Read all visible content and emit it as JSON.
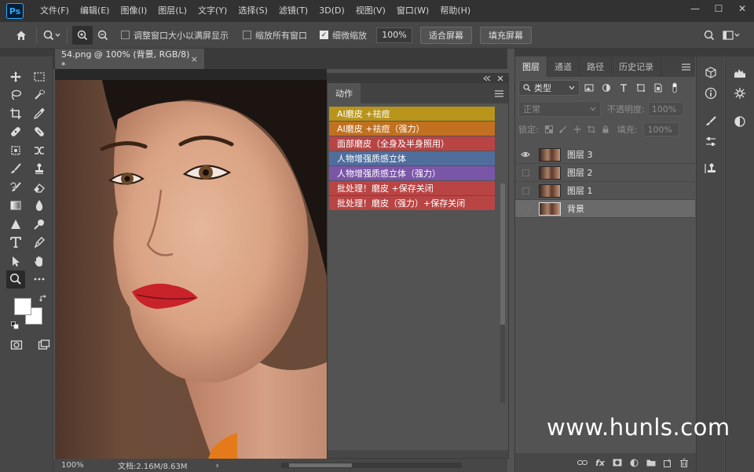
{
  "app": {
    "logo": "Ps",
    "menu": [
      "文件(F)",
      "编辑(E)",
      "图像(I)",
      "图层(L)",
      "文字(Y)",
      "选择(S)",
      "滤镜(T)",
      "3D(D)",
      "视图(V)",
      "窗口(W)",
      "帮助(H)"
    ],
    "window_controls": [
      "—",
      "☐",
      "✕"
    ]
  },
  "options": {
    "resize_windows_label": "调整窗口大小以满屏显示",
    "zoom_all_label": "缩放所有窗口",
    "scrubby_zoom_label": "细微缩放",
    "zoom_value": "100%",
    "fit_screen_label": "适合屏幕",
    "fill_screen_label": "填充屏幕"
  },
  "document": {
    "tab_title": "54.png @ 100% (背景, RGB/8) *",
    "close_glyph": "×"
  },
  "status": {
    "zoom": "100%",
    "doc_info": "文档:2.16M/8.63M",
    "arrow": "›"
  },
  "actions_panel": {
    "tab": "动作",
    "items": [
      {
        "label": "AI磨皮 +祛痘",
        "color": "#b8941a"
      },
      {
        "label": "AI磨皮 +祛痘（强力）",
        "color": "#c1711f"
      },
      {
        "label": "面部磨皮（全身及半身照用）",
        "color": "#b94444"
      },
      {
        "label": "人物增强质感立体",
        "color": "#4f6e9c"
      },
      {
        "label": "人物增强质感立体（强力）",
        "color": "#7a56a8"
      },
      {
        "label": "批处理！磨皮 +保存关闭",
        "color": "#b94444"
      },
      {
        "label": "批处理！磨皮（强力）+保存关闭",
        "color": "#b94444"
      }
    ]
  },
  "layers_panel": {
    "tabs": [
      "图层",
      "通道",
      "路径",
      "历史记录"
    ],
    "filter_label": "类型",
    "blend_mode": "正常",
    "opacity_label": "不透明度:",
    "opacity_value": "100%",
    "lock_label": "锁定:",
    "fill_label": "填充:",
    "fill_value": "100%",
    "layers": [
      {
        "name": "图层 3",
        "visible": true,
        "selected": false
      },
      {
        "name": "图层 2",
        "visible": false,
        "selected": false
      },
      {
        "name": "图层 1",
        "visible": false,
        "selected": false
      },
      {
        "name": "背景",
        "visible": false,
        "selected": true
      }
    ],
    "footer_icons": [
      "link-icon",
      "fx-icon",
      "mask-icon",
      "adjustment-icon",
      "group-icon",
      "new-layer-icon",
      "trash-icon"
    ],
    "fx_label": "fx"
  },
  "watermark": "www.hunls.com"
}
